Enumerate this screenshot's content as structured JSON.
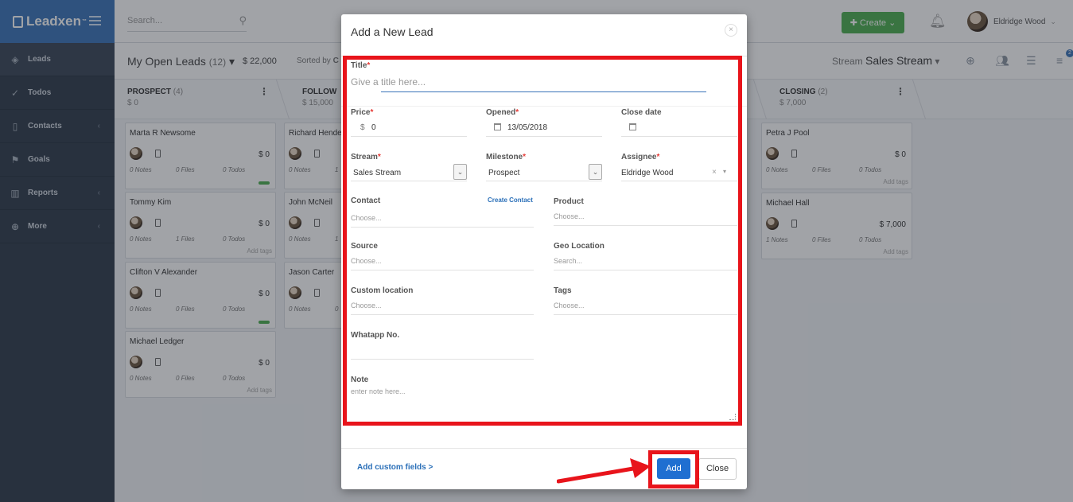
{
  "brand": {
    "name": "Leadxen",
    "tm": "™"
  },
  "sidebar": {
    "items": [
      {
        "label": "Leads",
        "icon": "layers-icon"
      },
      {
        "label": "Todos",
        "icon": "check-circle-icon"
      },
      {
        "label": "Contacts",
        "icon": "contact-card-icon"
      },
      {
        "label": "Goals",
        "icon": "flag-icon"
      },
      {
        "label": "Reports",
        "icon": "bar-chart-icon"
      },
      {
        "label": "More",
        "icon": "plus-circle-icon"
      }
    ]
  },
  "topbar": {
    "search_placeholder": "Search...",
    "create_label": "Create",
    "user_name": "Eldridge Wood"
  },
  "subhead": {
    "title": "My Open Leads",
    "count": "(12)",
    "total": "$ 22,000",
    "sorted_by": "Sorted by",
    "sorted_value": "C",
    "stream_label": "Stream",
    "stream_name": "Sales Stream",
    "filter_badge": "2"
  },
  "stages": [
    {
      "name": "PROSPECT",
      "count": "(4)",
      "amount": "$ 0"
    },
    {
      "name": "FOLLOW",
      "count": "",
      "amount": "$ 15,000"
    },
    {
      "name": "CLOSING",
      "count": "(2)",
      "amount": "$ 7,000"
    }
  ],
  "cards": {
    "prospect": [
      {
        "name": "Marta R Newsome",
        "amount": "$ 0",
        "notes": "0 Notes",
        "files": "0 Files",
        "todos": "0 Todos",
        "tags": ""
      },
      {
        "name": "Tommy Kim",
        "amount": "$ 0",
        "notes": "0 Notes",
        "files": "1 Files",
        "todos": "0 Todos",
        "tags": "Add tags"
      },
      {
        "name": "Clifton V Alexander",
        "amount": "$ 0",
        "notes": "0 Notes",
        "files": "0 Files",
        "todos": "0 Todos",
        "tags": ""
      },
      {
        "name": "Michael Ledger",
        "amount": "$ 0",
        "notes": "0 Notes",
        "files": "0 Files",
        "todos": "0 Todos",
        "tags": "Add tags"
      }
    ],
    "follow": [
      {
        "name": "Richard Hende",
        "notes": "0 Notes",
        "files": "1"
      },
      {
        "name": "John McNeil",
        "notes": "0 Notes",
        "files": "1"
      },
      {
        "name": "Jason Carter",
        "notes": "0 Notes",
        "files": "0"
      }
    ],
    "closing": [
      {
        "name": "Petra J Pool",
        "amount": "$ 0",
        "notes": "0 Notes",
        "files": "0 Files",
        "todos": "0 Todos",
        "tags": "Add tags"
      },
      {
        "name": "Michael Hall",
        "amount": "$ 7,000",
        "notes": "1 Notes",
        "files": "0 Files",
        "todos": "0 Todos",
        "tags": "Add tags"
      }
    ]
  },
  "modal": {
    "title": "Add a New Lead",
    "close_glyph": "×",
    "title_label": "Title",
    "title_placeholder": "Give a title here...",
    "price_label": "Price",
    "price_currency": "$",
    "price_value": "0",
    "opened_label": "Opened",
    "opened_value": "13/05/2018",
    "close_date_label": "Close date",
    "stream_label": "Stream",
    "stream_value": "Sales Stream",
    "milestone_label": "Milestone",
    "milestone_value": "Prospect",
    "assignee_label": "Assignee",
    "assignee_value": "Eldridge Wood",
    "contact_label": "Contact",
    "create_contact": "Create Contact",
    "contact_placeholder": "Choose...",
    "product_label": "Product",
    "product_placeholder": "Choose...",
    "source_label": "Source",
    "source_placeholder": "Choose...",
    "geo_label": "Geo Location",
    "geo_placeholder": "Search...",
    "custom_location_label": "Custom location",
    "custom_location_placeholder": "Choose...",
    "tags_label": "Tags",
    "tags_placeholder": "Choose...",
    "whatsapp_label": "Whatapp No.",
    "note_label": "Note",
    "note_placeholder": "enter note here...",
    "required_mark": "*",
    "custom_fields_link": "Add custom fields >",
    "add_button": "Add",
    "close_button": "Close"
  },
  "colors": {
    "highlight": "#e8141b",
    "primary": "#1f6fd1",
    "create": "#4caf50",
    "sidebar": "#2f3b4a"
  }
}
